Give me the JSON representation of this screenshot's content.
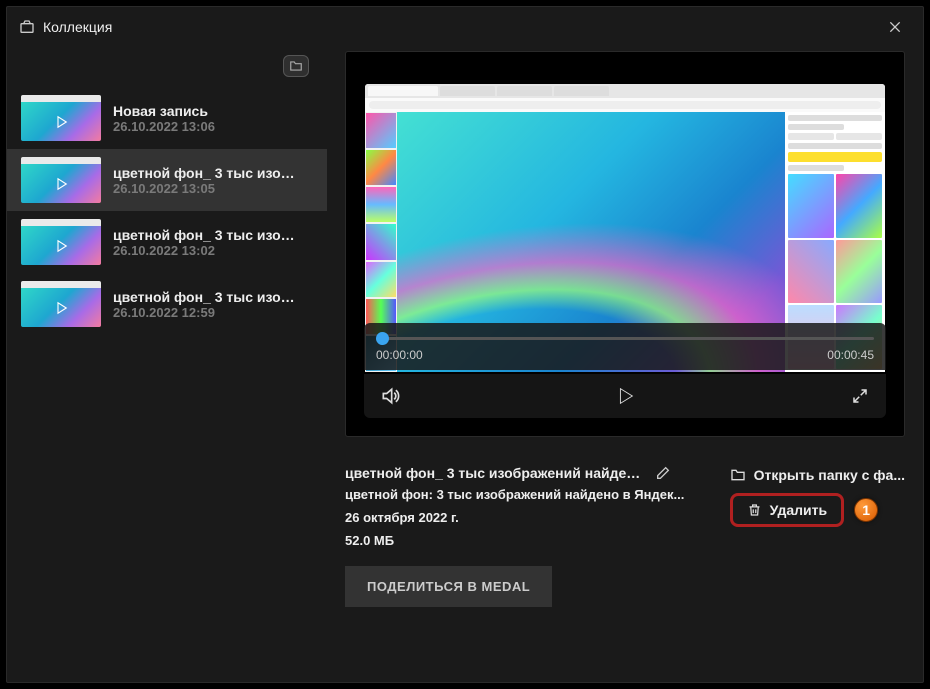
{
  "window": {
    "title": "Коллекция"
  },
  "sidebar": {
    "items": [
      {
        "title": "Новая запись",
        "date": "26.10.2022 13:06"
      },
      {
        "title": "цветной фон_ 3 тыс изобр...",
        "date": "26.10.2022 13:05"
      },
      {
        "title": "цветной фон_ 3 тыс изобр...",
        "date": "26.10.2022 13:02"
      },
      {
        "title": "цветной фон_ 3 тыс изобр...",
        "date": "26.10.2022 12:59"
      }
    ],
    "selected_index": 1
  },
  "player": {
    "current_time": "00:00:00",
    "duration": "00:00:45"
  },
  "details": {
    "name": "цветной фон_ 3 тыс изображений найдено в...",
    "description": "цветной фон: 3 тыс изображений найдено в Яндек...",
    "full_date": "26 октября 2022 г.",
    "size": "52.0 МБ",
    "share_label": "ПОДЕЛИТЬСЯ В MEDAL",
    "open_folder_label": "Открыть папку с фа...",
    "delete_label": "Удалить"
  },
  "callout": {
    "number": "1"
  }
}
